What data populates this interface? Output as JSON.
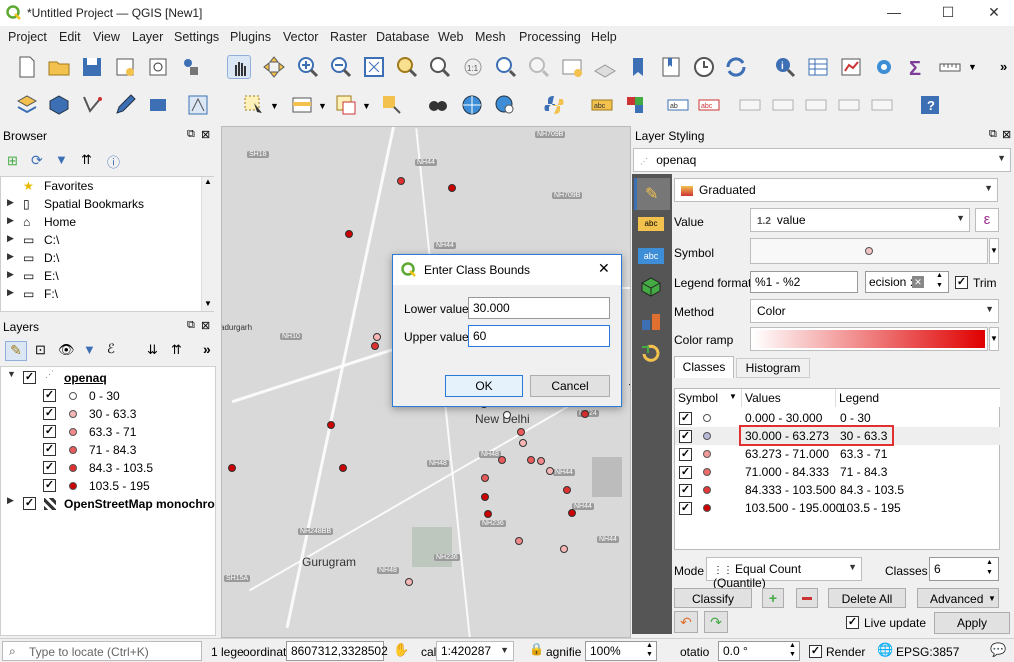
{
  "window": {
    "title": "*Untitled Project — QGIS [New1]",
    "controls": [
      "—",
      "☐",
      "✕"
    ]
  },
  "menu": [
    "Project",
    "Edit",
    "View",
    "Layer",
    "Settings",
    "Plugins",
    "Vector",
    "Raster",
    "Database",
    "Web",
    "Mesh",
    "Processing",
    "Help"
  ],
  "browser": {
    "title": "Browser",
    "items": [
      "Favorites",
      "Spatial Bookmarks",
      "Home",
      "C:\\",
      "D:\\",
      "E:\\",
      "F:\\"
    ]
  },
  "layers": {
    "title": "Layers",
    "layer1": "openaq",
    "classes": [
      "0 - 30",
      "30 - 63.3",
      "63.3 - 71",
      "71 - 84.3",
      "84.3 - 103.5",
      "103.5 - 195"
    ],
    "class_colors": [
      "#ffffff",
      "#f6b6b6",
      "#f08a8a",
      "#e95b5b",
      "#e03030",
      "#cc0000"
    ],
    "layer2": "OpenStreetMap monochro"
  },
  "map": {
    "labels": {
      "delhi": "New Delhi",
      "gurugram": "Gurugram",
      "adurgarh": "adurgarh"
    },
    "road_shields": [
      "NH709B",
      "NH44",
      "SH18",
      "NH709B",
      "NH44",
      "NH10",
      "NH48",
      "NH48",
      "NH248BB",
      "NH236",
      "NH236",
      "NH48",
      "NH44",
      "SH15A",
      "NH44",
      "NH44",
      "NH24"
    ]
  },
  "dialog": {
    "title": "Enter Class Bounds",
    "lower_label": "Lower value",
    "lower_value": "30.000",
    "upper_label": "Upper value",
    "upper_value": "60",
    "ok": "OK",
    "cancel": "Cancel"
  },
  "styling": {
    "title": "Layer Styling",
    "layer": "openaq",
    "renderer": "Graduated",
    "value_label": "Value",
    "value_field": "value",
    "value_field_prefix": "1.2",
    "symbol_label": "Symbol",
    "legend_format_label": "Legend format",
    "legend_format": "%1 - %2",
    "precision": "ecision :",
    "trim": "Trim",
    "method_label": "Method",
    "method": "Color",
    "color_ramp_label": "Color ramp",
    "tabs": [
      "Classes",
      "Histogram"
    ],
    "table_headers": [
      "Symbol",
      "Values",
      "Legend"
    ],
    "rows": [
      {
        "values": "0.000 - 30.000",
        "legend": "0 - 30"
      },
      {
        "values": "30.000 - 63.273",
        "legend": "30 - 63.3"
      },
      {
        "values": "63.273 - 71.000",
        "legend": "63.3 - 71"
      },
      {
        "values": "71.000 - 84.333",
        "legend": "71 - 84.3"
      },
      {
        "values": "84.333 - 103.500",
        "legend": "84.3 - 103.5"
      },
      {
        "values": "103.500 - 195.000",
        "legend": "103.5 - 195"
      }
    ],
    "row_colors": [
      "#ffffff",
      "#b9b9d9",
      "#f29a9a",
      "#ec6b6b",
      "#e23a3a",
      "#cc0000"
    ],
    "mode_label": "Mode",
    "mode": "Equal Count (Quantile)",
    "classes_label": "Classes",
    "classes": "6",
    "classify": "Classify",
    "delete_all": "Delete All",
    "advanced": "Advanced",
    "live_update": "Live update",
    "apply": "Apply"
  },
  "status": {
    "locate_placeholder": "Type to locate (Ctrl+K)",
    "legend_frag": "1 lege",
    "coord_label": "oordinat",
    "coord": "8607312,3328502",
    "scale_label": "cal",
    "scale": "1:420287",
    "mag_label": "agnifie",
    "mag": "100%",
    "rot_label": "otatio",
    "rot": "0.0 °",
    "render": "Render",
    "epsg": "EPSG:3857"
  }
}
